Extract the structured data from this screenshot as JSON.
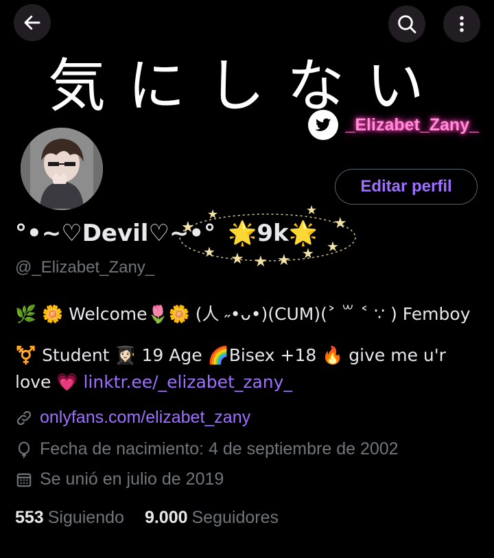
{
  "header": {
    "banner_text": "気にしない",
    "twitter_handle": "_Elizabet_Zany_"
  },
  "profile": {
    "display_name": "°•~♡Devil♡~•°",
    "display_name_suffix": "9k",
    "handle": "@_Elizabet_Zany_",
    "edit_button": "Editar perfil",
    "bio_line1": "🌿 🌼 Welcome🌷🌼 (人 ˶•ᴗ•)(CUM)(˃ ꒳ ˂ ∵ ) Femboy",
    "bio_line2_text": "⚧️ Student 👩🏻‍🎓 19 Age 🌈Bisex +18 🔥 give me u'r love 💗 ",
    "bio_link": "linktr.ee/_elizabet_zany_",
    "website": "onlyfans.com/elizabet_zany",
    "birthday": "Fecha de nacimiento: 4 de septiembre de 2002",
    "joined": "Se unió en julio de 2019"
  },
  "stats": {
    "following_count": "553",
    "following_label": "Siguiendo",
    "followers_count": "9.000",
    "followers_label": "Seguidores"
  },
  "colors": {
    "accent": "#9f6fff",
    "muted": "#71767b",
    "neon_pink": "#ff8fd6"
  }
}
